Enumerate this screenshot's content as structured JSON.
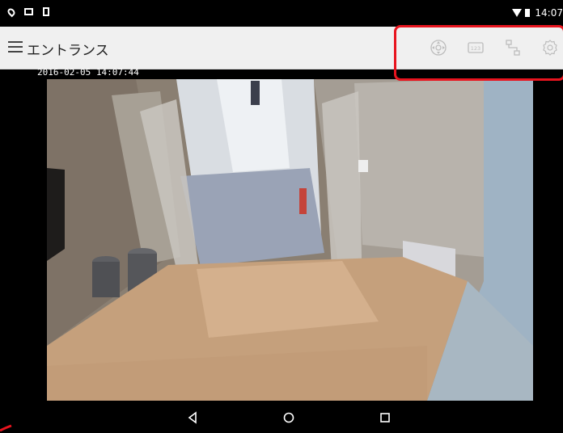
{
  "status_bar": {
    "time": "14:07",
    "left_icons": [
      "location-icon",
      "message-icon",
      "sim-icon"
    ],
    "right_icons": [
      "wifi-icon",
      "battery-icon"
    ]
  },
  "app_bar": {
    "title": "エントランス",
    "menu_icon": "hamburger-menu-icon",
    "actions": [
      {
        "name": "ptz-control-button",
        "icon": "ptz-joystick-icon"
      },
      {
        "name": "preset-button",
        "icon": "preset-number-icon",
        "label": "123"
      },
      {
        "name": "camera-switch-button",
        "icon": "camera-flow-icon"
      },
      {
        "name": "settings-button",
        "icon": "gear-icon"
      }
    ]
  },
  "camera": {
    "timestamp": "2016-02-05 14:07:44"
  },
  "annotation": {
    "highlight_color": "#e8141e"
  },
  "nav_bar": {
    "buttons": [
      "back-icon",
      "home-icon",
      "recents-icon"
    ]
  }
}
